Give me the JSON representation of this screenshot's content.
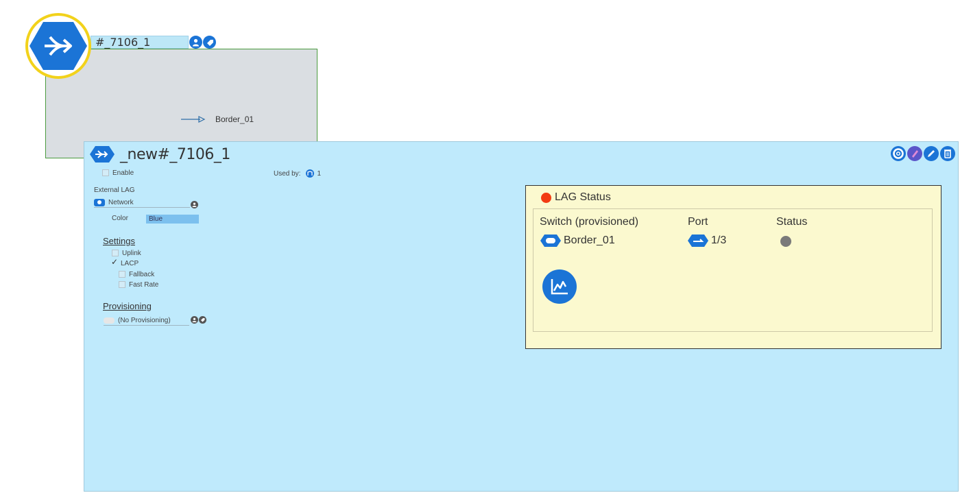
{
  "background_card": {
    "title": "#_7106_1",
    "member_label": "Border_01"
  },
  "panel": {
    "title": "_new#_7106_1",
    "enable_label": "Enable",
    "used_by_label": "Used by:",
    "used_by_count": "1",
    "external_lag_label": "External LAG",
    "network_value": "Network",
    "color_label": "Color",
    "color_value": "Blue",
    "settings_heading": "Settings",
    "settings": {
      "uplink": "Uplink",
      "lacp": "LACP",
      "fallback": "Fallback",
      "fast_rate": "Fast Rate"
    },
    "provisioning_heading": "Provisioning",
    "provisioning_value": "(No Provisioning)"
  },
  "lag_status": {
    "title": "LAG Status",
    "columns": {
      "switch": "Switch (provisioned)",
      "port": "Port",
      "status": "Status"
    },
    "row": {
      "switch": "Border_01",
      "port": "1/3"
    }
  },
  "colors": {
    "accent": "#1b74d6",
    "panel_bg": "#bfeafc",
    "status_box_bg": "#fbf9cf",
    "status_red": "#f23b12",
    "status_grey": "#7a7a7a",
    "highlight_ring": "#f2d21b"
  },
  "icons": {
    "lag_hexagon": "lag-merge-icon",
    "user": "user-icon",
    "tag": "tag-icon",
    "lifebuoy": "lifebuoy-icon",
    "brush": "brush-icon",
    "edit": "pencil-icon",
    "delete": "trash-icon",
    "chart": "chart-icon"
  }
}
